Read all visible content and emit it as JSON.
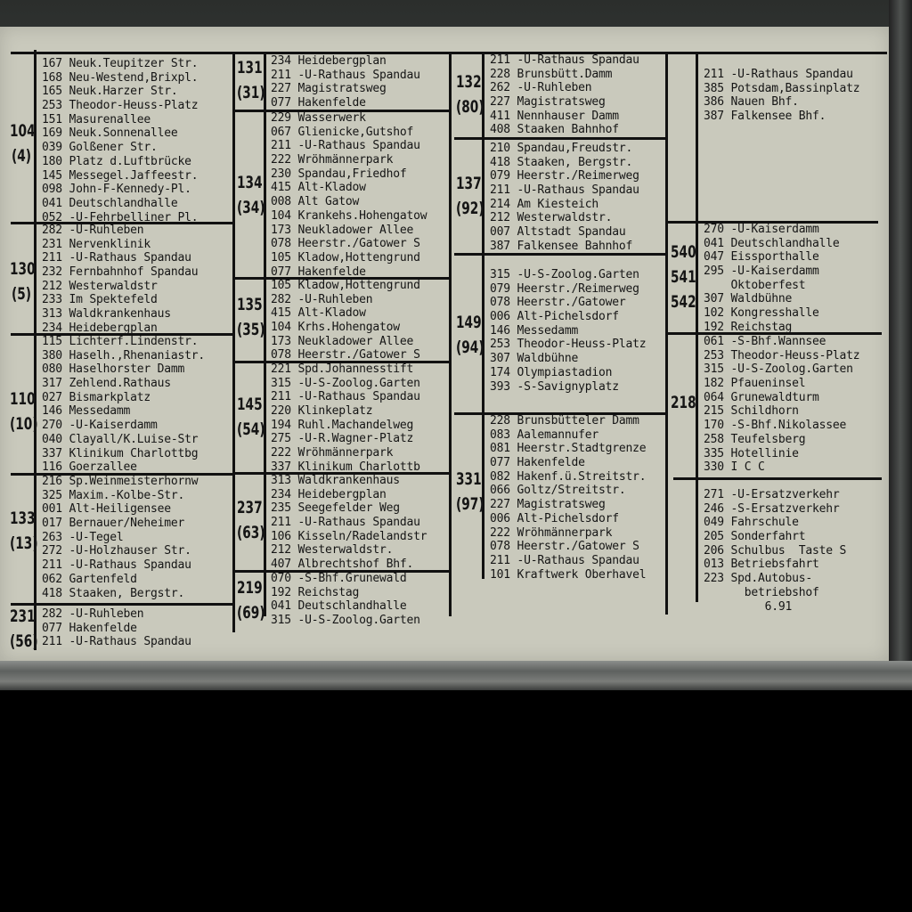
{
  "groups": [
    {
      "id": "104",
      "paren": "(4)",
      "stops": [
        "167 Neuk.Teupitzer Str.",
        "168 Neu-Westend,Brixpl.",
        "165 Neuk.Harzer Str.",
        "253 Theodor-Heuss-Platz",
        "151 Masurenallee",
        "169 Neuk.Sonnenallee",
        "039 Golßener Str.",
        "180 Platz d.Luftbrücke",
        "145 Messegel.Jaffeestr.",
        "098 John-F-Kennedy-Pl.",
        "041 Deutschlandhalle",
        "052 -U-Fehrbelliner Pl."
      ]
    },
    {
      "id": "130",
      "paren": "(5)",
      "stops": [
        "282 -U-Ruhleben",
        "231 Nervenklinik",
        "211 -U-Rathaus Spandau",
        "232 Fernbahnhof Spandau",
        "212 Westerwaldstr",
        "233 Im Spektefeld",
        "313 Waldkrankenhaus",
        "234 Heidebergplan"
      ]
    },
    {
      "id": "110",
      "paren": "(10)",
      "stops": [
        "115 Lichterf.Lindenstr.",
        "380 Haselh.,Rhenaniastr.",
        "080 Haselhorster Damm",
        "317 Zehlend.Rathaus",
        "027 Bismarkplatz",
        "146 Messedamm",
        "270 -U-Kaiserdamm",
        "040 Clayall/K.Luise-Str",
        "337 Klinikum Charlottbg",
        "116 Goerzallee"
      ]
    },
    {
      "id": "133",
      "paren": "(13)",
      "stops": [
        "216 Sp.Weinmeisterhornw",
        "325 Maxim.-Kolbe-Str.",
        "001 Alt-Heiligensee",
        "017 Bernauer/Neheimer",
        "263 -U-Tegel",
        "272 -U-Holzhauser Str.",
        "211 -U-Rathaus Spandau",
        "062 Gartenfeld",
        "418 Staaken, Bergstr."
      ]
    },
    {
      "id": "231",
      "paren": "(56)",
      "stops": [
        "282 -U-Ruhleben",
        "077 Hakenfelde",
        "211 -U-Rathaus Spandau"
      ]
    },
    {
      "id": "131",
      "paren": "(31)",
      "stops": [
        "234 Heidebergplan",
        "211 -U-Rathaus Spandau",
        "227 Magistratsweg",
        "077 Hakenfelde"
      ]
    },
    {
      "id": "134",
      "paren": "(34)",
      "stops": [
        "229 Wasserwerk",
        "067 Glienicke,Gutshof",
        "211 -U-Rathaus Spandau",
        "222 Wröhmännerpark",
        "230 Spandau,Friedhof",
        "415 Alt-Kladow",
        "008 Alt Gatow",
        "104 Krankehs.Hohengatow",
        "173 Neukladower Allee",
        "078 Heerstr./Gatower S",
        "105 Kladow,Hottengrund",
        "077 Hakenfelde"
      ]
    },
    {
      "id": "135",
      "paren": "(35)",
      "stops": [
        "105 Kladow,Hottengrund",
        "282 -U-Ruhleben",
        "415 Alt-Kladow",
        "104 Krhs.Hohengatow",
        "173 Neukladower Allee",
        "078 Heerstr./Gatower S"
      ]
    },
    {
      "id": "145",
      "paren": "(54)",
      "stops": [
        "221 Spd.Johannesstift",
        "315 -U-S-Zoolog.Garten",
        "211 -U-Rathaus Spandau",
        "220 Klinkeplatz",
        "194 Ruhl.Machandelweg",
        "275 -U-R.Wagner-Platz",
        "222 Wröhmännerpark",
        "337 Klinikum Charlottb"
      ]
    },
    {
      "id": "237",
      "paren": "(63)",
      "stops": [
        "313 Waldkrankenhaus",
        "234 Heidebergplan",
        "235 Seegefelder Weg",
        "211 -U-Rathaus Spandau",
        "106 Kisseln/Radelandstr",
        "212 Westerwaldstr.",
        "407 Albrechtshof Bhf."
      ]
    },
    {
      "id": "219",
      "paren": "(69)",
      "stops": [
        "070 -S-Bhf.Grunewald",
        "192 Reichstag",
        "041 Deutschlandhalle",
        "315 -U-S-Zoolog.Garten"
      ]
    },
    {
      "id": "132",
      "paren": "(80)",
      "stops": [
        "211 -U-Rathaus Spandau",
        "228 Brunsbütt.Damm",
        "262 -U-Ruhleben",
        "227 Magistratsweg",
        "411 Nennhauser Damm",
        "408 Staaken Bahnhof"
      ]
    },
    {
      "id": "137",
      "paren": "(92)",
      "stops": [
        "210 Spandau,Freudstr.",
        "418 Staaken, Bergstr.",
        "079 Heerstr./Reimerweg",
        "211 -U-Rathaus Spandau",
        "214 Am Kiesteich",
        "212 Westerwaldstr.",
        "007 Altstadt Spandau",
        "387 Falkensee Bahnhof"
      ]
    },
    {
      "id": "149",
      "paren": "(94)",
      "stops": [
        "315 -U-S-Zoolog.Garten",
        "079 Heerstr./Reimerweg",
        "078 Heerstr./Gatower",
        "006 Alt-Pichelsdorf",
        "146 Messedamm",
        "253 Theodor-Heuss-Platz",
        "307 Waldbühne",
        "174 Olympiastadion",
        "393 -S-Savignyplatz"
      ]
    },
    {
      "id": "331",
      "paren": "(97)",
      "stops": [
        "228 Brunsbütteler Damm",
        "083 Aalemannufer",
        "081 Heerstr.Stadtgrenze",
        "077 Hakenfelde",
        "082 Hakenf.ü.Streitstr.",
        "066 Goltz/Streitstr.",
        "227 Magistratsweg",
        "006 Alt-Pichelsdorf",
        "222 Wröhmännerpark",
        "078 Heerstr./Gatower S",
        "211 -U-Rathaus Spandau",
        "101 Kraftwerk Oberhavel"
      ]
    },
    {
      "id": "",
      "paren": "",
      "stops": [
        "211 -U-Rathaus Spandau",
        "385 Potsdam,Bassinplatz",
        "386 Nauen Bhf.",
        "387 Falkensee Bhf."
      ]
    },
    {
      "id": "540",
      "id2": "541",
      "id3": "542",
      "stops": [
        "270 -U-Kaiserdamm",
        "041 Deutschlandhalle",
        "047 Eissporthalle",
        "295 -U-Kaiserdamm",
        "    Oktoberfest",
        "307 Waldbühne",
        "102 Kongresshalle",
        "192 Reichstag"
      ]
    },
    {
      "id": "218",
      "paren": "",
      "stops": [
        "061 -S-Bhf.Wannsee",
        "253 Theodor-Heuss-Platz",
        "315 -U-S-Zoolog.Garten",
        "182 Pfaueninsel",
        "064 Grunewaldturm",
        "215 Schildhorn",
        "170 -S-Bhf.Nikolassee",
        "258 Teufelsberg",
        "335 Hotellinie",
        "330 I C C"
      ]
    },
    {
      "id": "",
      "paren": "",
      "stops": [
        "271 -U-Ersatzverkehr",
        "246 -S-Ersatzverkehr",
        "049 Fahrschule",
        "205 Sonderfahrt",
        "206 Schulbus  Taste S",
        "013 Betriebsfahrt",
        "223 Spd.Autobus-",
        "      betriebshof",
        "         6.91"
      ]
    }
  ]
}
